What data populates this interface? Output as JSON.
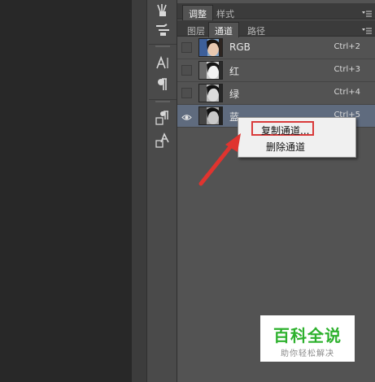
{
  "panel_top_tabs": [
    {
      "label": "调整",
      "active": true
    },
    {
      "label": "样式",
      "active": false
    }
  ],
  "panel_tabs": [
    {
      "label": "图层",
      "active": false
    },
    {
      "label": "通道",
      "active": true
    },
    {
      "label": "路径",
      "active": false
    }
  ],
  "channels": [
    {
      "name": "RGB",
      "shortcut": "Ctrl+2",
      "visible": false,
      "selected": false,
      "thumb": "color"
    },
    {
      "name": "红",
      "shortcut": "Ctrl+3",
      "visible": false,
      "selected": false,
      "thumb": "gray"
    },
    {
      "name": "绿",
      "shortcut": "Ctrl+4",
      "visible": false,
      "selected": false,
      "thumb": "gray"
    },
    {
      "name": "蓝",
      "shortcut": "Ctrl+5",
      "visible": true,
      "selected": true,
      "thumb": "gray"
    }
  ],
  "context_menu": {
    "items": [
      {
        "label": "复制通道...",
        "highlighted": true
      },
      {
        "label": "删除通道",
        "highlighted": false
      }
    ]
  },
  "toolbar_icons": [
    "brush-presets-icon",
    "clone-source-icon",
    "character-icon",
    "paragraph-icon",
    "paragraph-styles-icon",
    "character-styles-icon"
  ],
  "watermark": {
    "title": "百科全说",
    "subtitle": "助你轻松解决"
  },
  "colors": {
    "annotation_red": "#d93a3a",
    "selected_row": "#5f6b7e",
    "watermark_green": "#2db12d"
  }
}
